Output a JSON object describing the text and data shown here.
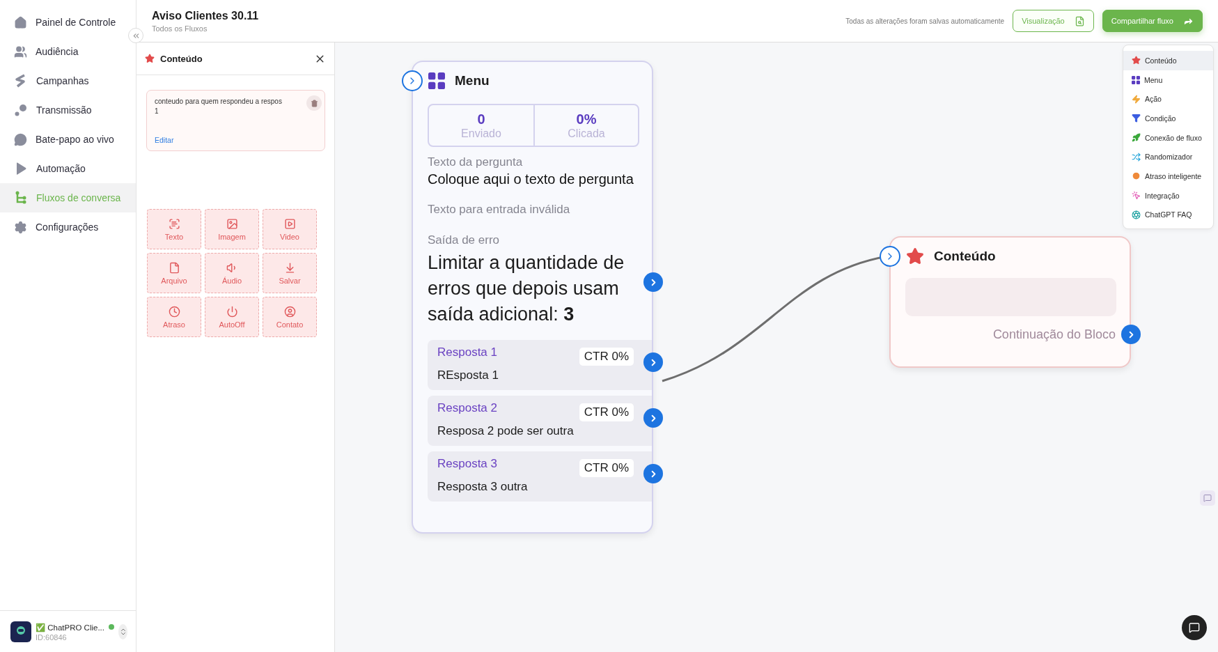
{
  "sidebar": {
    "items": [
      {
        "label": "Painel de Controle",
        "selected": false
      },
      {
        "label": "Audiência",
        "selected": false
      },
      {
        "label": "Campanhas",
        "selected": false
      },
      {
        "label": "Transmissão",
        "selected": false
      },
      {
        "label": "Bate-papo ao vivo",
        "selected": false
      },
      {
        "label": "Automação",
        "selected": false
      },
      {
        "label": "Fluxos de conversa",
        "selected": true
      },
      {
        "label": "Configurações",
        "selected": false
      }
    ],
    "account": {
      "name": "✅ ChatPRO Clie...",
      "id": "ID:60846",
      "online": true
    }
  },
  "header": {
    "title": "Aviso Clientes 30.11",
    "subtitle": "Todos os Fluxos",
    "autosave_note": "Todas as alterações foram salvas automaticamente",
    "buttons": [
      {
        "label": "Visualização",
        "kind": "outline"
      },
      {
        "label": "Compartilhar fluxo",
        "kind": "primary"
      }
    ]
  },
  "panel": {
    "title": "Conteúdo",
    "message": {
      "text": "conteudo para quem respondeu a respos\n1",
      "link": "Editar"
    },
    "tools": [
      "Texto",
      "Imagem",
      "Video",
      "Arquivo",
      "Áudio",
      "Salvar",
      "Atraso",
      "AutoOff",
      "Contato"
    ]
  },
  "canvas": {
    "menu_node": {
      "title": "Menu",
      "stats": [
        {
          "value": "0",
          "label": "Enviado"
        },
        {
          "value": "0%",
          "label": "Clicada"
        }
      ],
      "question_label": "Texto da pergunta",
      "question_text": "Coloque aqui o texto de pergunta",
      "invalid_label": "Texto para entrada inválida",
      "error_label": "Saída de erro",
      "error_text": "Limitar a quantidade de erros que depois usam saída adicional: **3**",
      "answers": [
        {
          "title": "Resposta 1",
          "ctr": "CTR 0%",
          "text": "REsposta 1"
        },
        {
          "title": "Resposta 2",
          "ctr": "CTR 0%",
          "text": "Resposa 2 pode ser outra"
        },
        {
          "title": "Resposta 3",
          "ctr": "CTR 0%",
          "text": "Resposta 3 outra"
        }
      ]
    },
    "content_node": {
      "title": "Conteúdo",
      "continuation": "Continuação do Bloco"
    },
    "block_menu": [
      {
        "label": "Conteúdo",
        "selected": true
      },
      {
        "label": "Menu",
        "selected": false
      },
      {
        "label": "Ação",
        "selected": false
      },
      {
        "label": "Condição",
        "selected": false
      },
      {
        "label": "Conexão de fluxo",
        "selected": false
      },
      {
        "label": "Randomizador",
        "selected": false
      },
      {
        "label": "Atraso inteligente",
        "selected": false
      },
      {
        "label": "Integração",
        "selected": false
      },
      {
        "label": "ChatGPT FAQ",
        "selected": false
      }
    ]
  }
}
